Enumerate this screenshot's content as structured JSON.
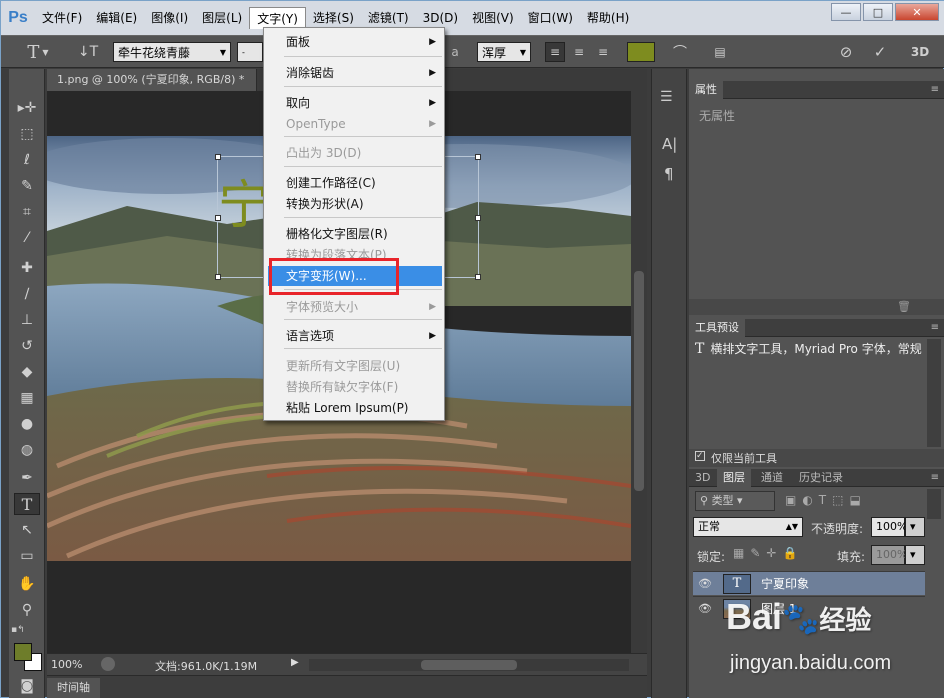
{
  "menubar": {
    "logo": "Ps",
    "items": [
      "文件(F)",
      "编辑(E)",
      "图像(I)",
      "图层(L)",
      "文字(Y)",
      "选择(S)",
      "滤镜(T)",
      "3D(D)",
      "视图(V)",
      "窗口(W)",
      "帮助(H)"
    ],
    "active_index": 4,
    "minimize": "—",
    "maximize": "□",
    "close": "✕"
  },
  "options": {
    "tool_glyph": "T",
    "font_name": "牵牛花绕青藤",
    "size_unit": "a",
    "aa_mode": "浑厚",
    "accent": "#7e8c1f"
  },
  "document": {
    "tab_title": "1.png @ 100% (宁夏印象, RGB/8) *",
    "tab_close": "×",
    "overlay_text": "宁夏印象",
    "zoom": "100%",
    "doc_size": "文档:961.0K/1.19M",
    "timeline_label": "时间轴"
  },
  "text_menu": {
    "items": [
      {
        "label": "面板",
        "submenu": true,
        "disabled": false
      },
      {
        "label": "消除锯齿",
        "submenu": true,
        "disabled": false
      },
      {
        "label": "取向",
        "submenu": true,
        "disabled": false
      },
      {
        "label": "OpenType",
        "submenu": true,
        "disabled": true
      },
      {
        "label": "凸出为 3D(D)",
        "submenu": false,
        "disabled": true
      },
      {
        "label": "创建工作路径(C)",
        "submenu": false,
        "disabled": false
      },
      {
        "label": "转换为形状(A)",
        "submenu": false,
        "disabled": false
      },
      {
        "label": "栅格化文字图层(R)",
        "submenu": false,
        "disabled": false
      },
      {
        "label": "转换为段落文本(P)",
        "submenu": false,
        "disabled": true
      },
      {
        "label": "文字变形(W)...",
        "submenu": false,
        "disabled": false,
        "highlighted": true
      },
      {
        "label": "字体预览大小",
        "submenu": true,
        "disabled": true
      },
      {
        "label": "语言选项",
        "submenu": true,
        "disabled": false
      },
      {
        "label": "更新所有文字图层(U)",
        "submenu": false,
        "disabled": true
      },
      {
        "label": "替换所有缺欠字体(F)",
        "submenu": false,
        "disabled": true
      },
      {
        "label": "粘贴 Lorem Ipsum(P)",
        "submenu": false,
        "disabled": false
      }
    ]
  },
  "panels": {
    "properties_tab": "属性",
    "properties_empty": "无属性",
    "tool_presets_tab": "工具预设",
    "tool_preset_item": "横排文字工具，Myriad Pro 字体，常规",
    "current_tool_only": "仅限当前工具",
    "layer_tabs": [
      "3D",
      "图层",
      "通道",
      "历史记录"
    ],
    "layer_filter": "类型",
    "blend_mode": "正常",
    "opacity_label": "不透明度:",
    "opacity_value": "100%",
    "lock_label": "锁定:",
    "fill_label": "填充:",
    "fill_value": "100%",
    "layers": [
      {
        "name": "宁夏印象",
        "type": "text",
        "selected": true
      },
      {
        "name": "图层 1",
        "type": "image",
        "selected": false
      }
    ]
  },
  "watermark": {
    "brand": "Bai",
    "brand2": "经验",
    "url": "jingyan.baidu.com"
  }
}
